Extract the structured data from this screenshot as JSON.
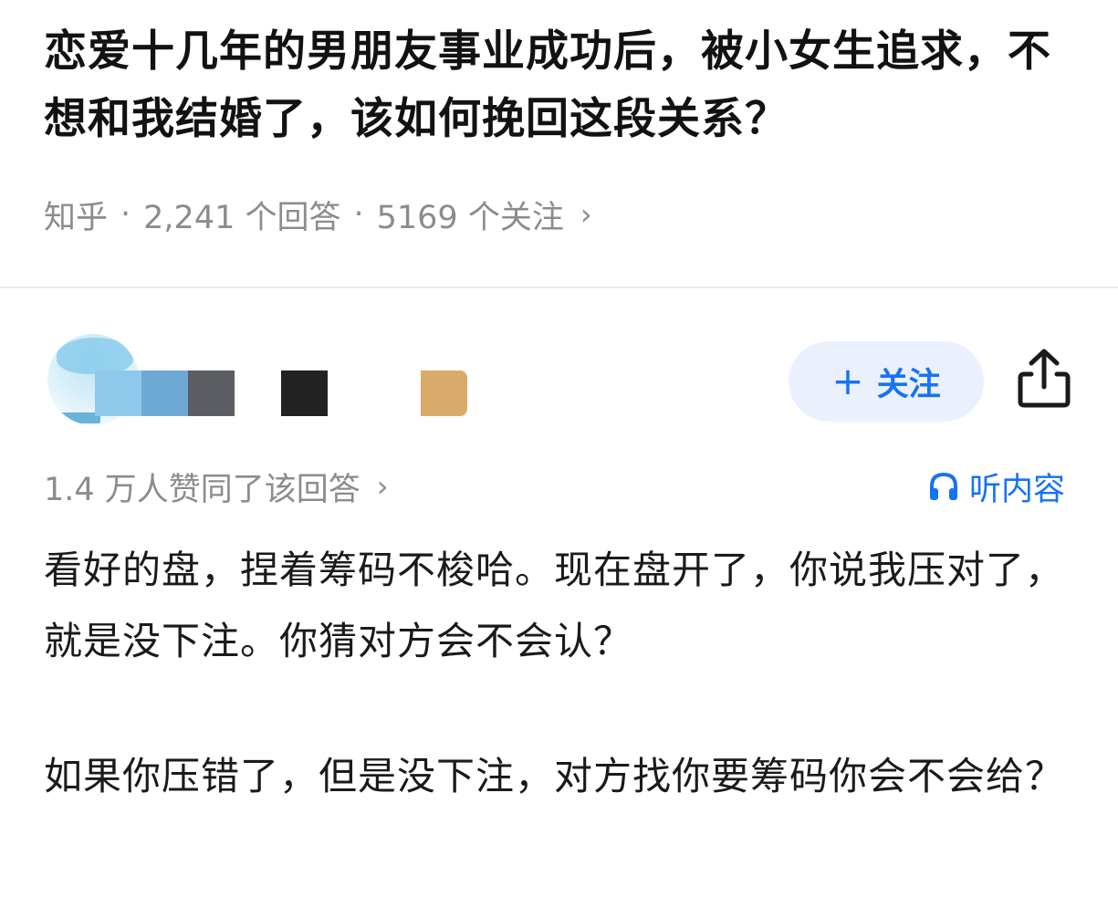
{
  "question": {
    "title": "恋爱十几年的男朋友事业成功后，被小女生追求，不想和我结婚了，该如何挽回这段关系？",
    "source": "知乎",
    "answers_count": "2,241 个回答",
    "followers_count": "5169 个关注"
  },
  "author": {
    "name_blocks": [
      {
        "color": "#8ec9ec"
      },
      {
        "color": "#6ea9d3"
      },
      {
        "color": "#5b5d63"
      },
      {
        "color": "#ffffff"
      },
      {
        "color": "#222222"
      },
      {
        "color": "#ffffff"
      },
      {
        "color": "#ffffff"
      },
      {
        "color": "#d9ab6a"
      }
    ],
    "follow_label": "关注",
    "follow_icon": "plus-icon",
    "share_icon": "share-icon"
  },
  "answer": {
    "approval_text": "1.4 万人赞同了该回答",
    "listen_label": "听内容",
    "listen_icon": "headphones-icon",
    "paragraphs": [
      "看好的盘，捏着筹码不梭哈。现在盘开了，你说我压对了，就是没下注。你猜对方会不会认？",
      "如果你压错了，但是没下注，对方找你要筹码你会不会给？"
    ]
  },
  "colors": {
    "accent": "#1772f6",
    "follow_bg": "#eaf1fd",
    "muted_text": "#8c8c8c"
  }
}
